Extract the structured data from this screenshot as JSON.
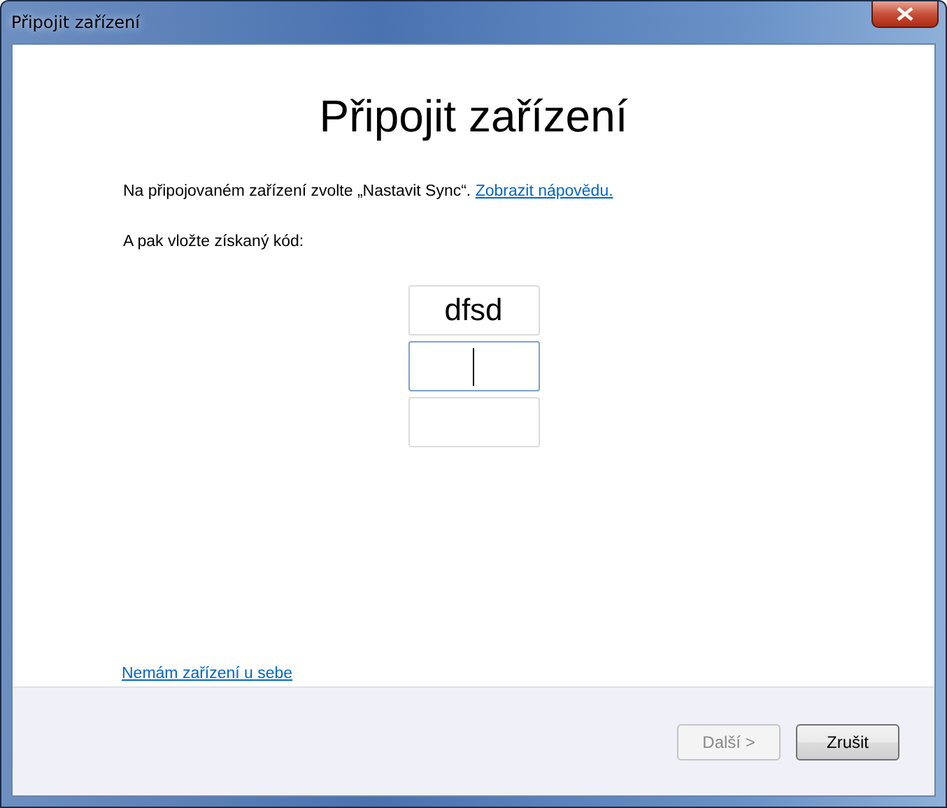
{
  "window": {
    "title": "Připojit zařízení"
  },
  "heading": "Připojit zařízení",
  "instruction": {
    "text": "Na připojovaném zařízení zvolte „Nastavit Sync“.",
    "link": "Zobrazit nápovědu."
  },
  "prompt": "A pak vložte získaný kód:",
  "code_fields": [
    {
      "value": "dfsd",
      "focused": false
    },
    {
      "focused": true
    },
    {
      "focused": false
    }
  ],
  "footer_link": "Nemám zařízení u sebe",
  "buttons": [
    {
      "label": "Další >",
      "disabled": true
    },
    {
      "label": "Zrušit",
      "disabled": false
    }
  ]
}
